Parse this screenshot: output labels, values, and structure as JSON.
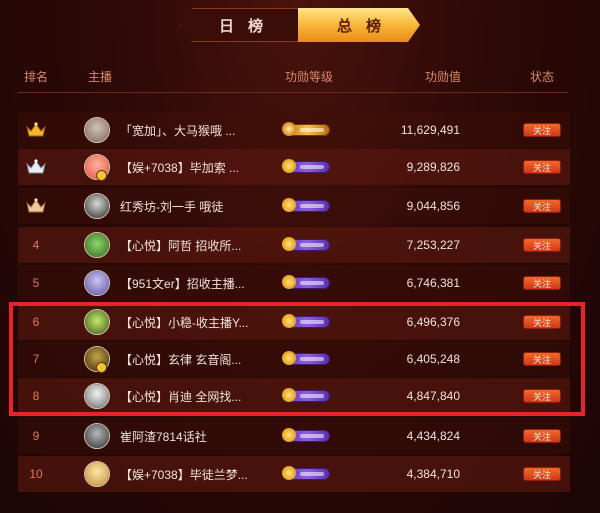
{
  "tabs": {
    "daily": "日榜",
    "total": "总榜"
  },
  "header": {
    "rank": "排名",
    "streamer": "主播",
    "level": "功勋等级",
    "merit": "功勋值",
    "status": "状态"
  },
  "colors": {
    "accent": "#f7b233",
    "follow_button": "#e0451f",
    "highlight_box": "#e8232a"
  },
  "rows": [
    {
      "rank": "",
      "rank_icon": "gold-crown-icon",
      "name": "「宽加」、大马猴哦 ...",
      "level_badge": "gold-level-badge",
      "value": "11,629,491",
      "follow": "关注"
    },
    {
      "rank": "",
      "rank_icon": "silver-crown-icon",
      "name": "【娱+7038】毕加索 ...",
      "level_badge": "purple-level-badge",
      "value": "9,289,826",
      "follow": "关注"
    },
    {
      "rank": "",
      "rank_icon": "bronze-crown-icon",
      "name": "红秀坊-刘一手 哦徒",
      "level_badge": "purple-level-badge",
      "value": "9,044,856",
      "follow": "关注"
    },
    {
      "rank": "4",
      "name": "【心悦】阿哲 招收所...",
      "level_badge": "purple-level-badge",
      "value": "7,253,227",
      "follow": "关注"
    },
    {
      "rank": "5",
      "name": "【951文er】招收主播...",
      "level_badge": "purple-level-badge",
      "value": "6,746,381",
      "follow": "关注"
    },
    {
      "rank": "6",
      "name": "【心悦】小稳-收主播Y...",
      "level_badge": "purple-level-badge",
      "value": "6,496,376",
      "follow": "关注"
    },
    {
      "rank": "7",
      "name": "【心悦】玄律 玄音阁...",
      "level_badge": "purple-level-badge",
      "value": "6,405,248",
      "follow": "关注"
    },
    {
      "rank": "8",
      "name": "【心悦】肖迪 全网找...",
      "level_badge": "purple-level-badge",
      "value": "4,847,840",
      "follow": "关注"
    },
    {
      "rank": "9",
      "name": "崔阿渣7814话社",
      "level_badge": "purple-level-badge",
      "value": "4,434,824",
      "follow": "关注"
    },
    {
      "rank": "10",
      "name": "【娱+7038】毕徒兰梦...",
      "level_badge": "purple-level-badge",
      "value": "4,384,710",
      "follow": "关注"
    }
  ]
}
